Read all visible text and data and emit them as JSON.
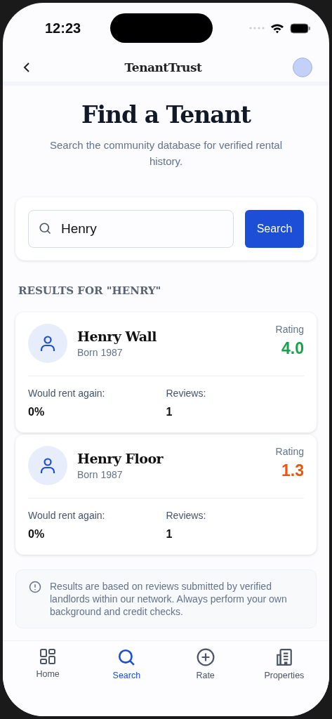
{
  "status_bar": {
    "time": "12:23"
  },
  "header": {
    "title": "TenantTrust"
  },
  "page": {
    "title": "Find a Tenant",
    "subtitle": "Search the community database for verified rental history."
  },
  "search": {
    "value": "Henry",
    "button": "Search"
  },
  "results_heading": "RESULTS FOR \"HENRY\"",
  "results": [
    {
      "name": "Henry Wall",
      "born": "Born 1987",
      "rating_label": "Rating",
      "rating": "4.0",
      "color": "#16a34a",
      "rent_again_label": "Would rent again:",
      "rent_again": "0%",
      "reviews_label": "Reviews:",
      "reviews": "1"
    },
    {
      "name": "Henry Floor",
      "born": "Born 1987",
      "rating_label": "Rating",
      "rating": "1.3",
      "color": "#ea580c",
      "rent_again_label": "Would rent again:",
      "rent_again": "0%",
      "reviews_label": "Reviews:",
      "reviews": "1"
    }
  ],
  "notice": "Results are based on reviews submitted by verified landlords within our network. Always perform your own background and credit checks.",
  "tabs": [
    {
      "label": "Home",
      "kind": "grid",
      "selected": false
    },
    {
      "label": "Search",
      "kind": "search",
      "selected": true
    },
    {
      "label": "Rate",
      "kind": "plus",
      "selected": false
    },
    {
      "label": "Properties",
      "kind": "building",
      "selected": false
    }
  ]
}
